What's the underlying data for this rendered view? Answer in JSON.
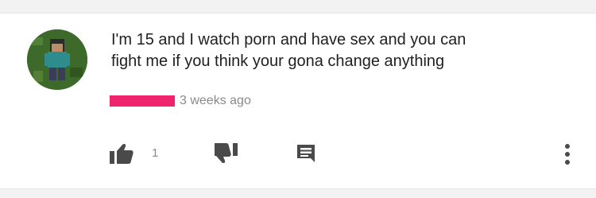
{
  "comment": {
    "text_line1": "I'm 15 and I watch porn and have sex and you can",
    "text_line2": "fight me if you think your gona change anything",
    "timestamp": "3 weeks ago",
    "like_count": "1"
  },
  "colors": {
    "redaction": "#f0246c",
    "meta_text": "#8a8a8a",
    "icon": "#4a4a4a"
  },
  "icons": {
    "like": "thumb-up-icon",
    "dislike": "thumb-down-icon",
    "reply": "reply-icon",
    "more": "more-vert-icon"
  }
}
